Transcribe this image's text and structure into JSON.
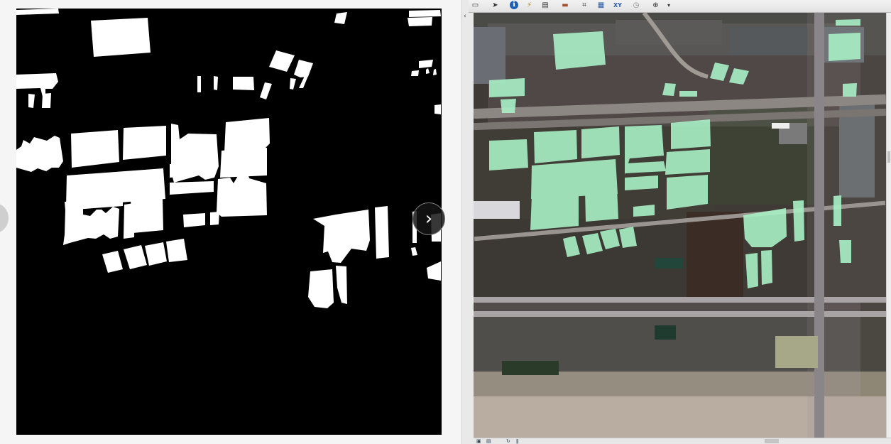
{
  "left_panel": {
    "mask_image": {
      "label": "segmentation-mask"
    },
    "nav": {
      "next_glyph": "›"
    }
  },
  "right_panel": {
    "collapse_arrow": "‹",
    "toolbar": {
      "icons": [
        {
          "name": "page-icon",
          "glyph": "▭"
        },
        {
          "name": "select-arrow-icon",
          "glyph": "➤"
        },
        {
          "name": "identify-icon",
          "glyph": "ℹ"
        },
        {
          "name": "html-popup-icon",
          "glyph": "⚡"
        },
        {
          "name": "hyperlink-icon",
          "glyph": "▤"
        },
        {
          "name": "measure-icon",
          "glyph": "▬"
        },
        {
          "name": "find-icon",
          "glyph": "⌗"
        },
        {
          "name": "find-route-icon",
          "glyph": "▦"
        },
        {
          "name": "goto-xy-icon",
          "glyph": "XY"
        },
        {
          "name": "time-slider-icon",
          "glyph": "◷"
        },
        {
          "name": "zoom-window-icon",
          "glyph": "⊕"
        },
        {
          "name": "toolbar-options-icon",
          "glyph": "▾"
        }
      ]
    },
    "map": {
      "overlay_color": "#a8f0c6"
    }
  }
}
